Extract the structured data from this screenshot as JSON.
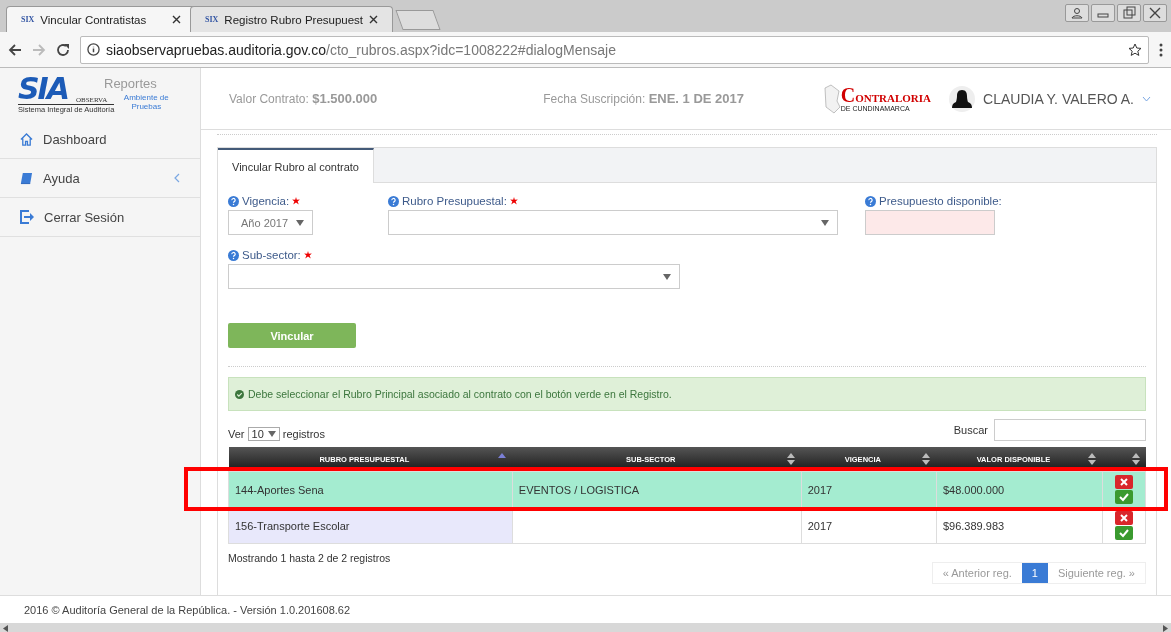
{
  "browser": {
    "tabs": [
      {
        "favicon": "SIX",
        "title": "Vincular Contratistas",
        "selected": true
      },
      {
        "favicon": "SIX",
        "title": "Registro Rubro Presupuest",
        "selected": false
      }
    ],
    "url_host": "siaobservapruebas.auditoria.gov.co",
    "url_path": "/cto_rubros.aspx?idc=1008222#dialogMensaje"
  },
  "header": {
    "logo_text": "SIA",
    "logo_sub": "OBSERVA",
    "logo_caption": "Sistema Integral de Auditoría",
    "environment": "Ambiente de Pruebas",
    "faded_menu": "Reportes",
    "contract_value_label": "Valor Contrato:",
    "contract_value": "$1.500.000",
    "date_label": "Fecha Suscripción:",
    "date_value": "ENE. 1 DE 2017",
    "agency_logo": "CONTRALORIA",
    "agency_sub": "DE CUNDINAMARCA",
    "user": "CLAUDIA Y. VALERO A."
  },
  "sidebar": {
    "items": [
      {
        "kind": "home",
        "label": "Dashboard",
        "submenu": false
      },
      {
        "kind": "book",
        "label": "Ayuda",
        "submenu": true
      },
      {
        "kind": "exit",
        "label": "Cerrar Sesión",
        "submenu": false
      }
    ]
  },
  "panel": {
    "tabs": [
      {
        "label": "Vincular Rubro al contrato",
        "selected": true
      }
    ],
    "fields": [
      {
        "kind": "select",
        "label": "Vigencia:",
        "required": true,
        "value": "Año 2017"
      },
      {
        "kind": "select",
        "label": "Rubro Presupuestal:",
        "required": true
      },
      {
        "kind": "input",
        "label": "Presupuesto disponible:",
        "required": false
      },
      {
        "kind": "select",
        "label": "Sub-sector:",
        "required": true
      }
    ],
    "button": "Vincular",
    "alert": "Debe seleccionar el Rubro Principal asociado al contrato con el botón verde en el Registro.",
    "table": {
      "length_prefix": "Ver",
      "length_value": "10",
      "length_suffix": "registros",
      "search_label": "Buscar",
      "columns": [
        {
          "label": "RUBRO PRESUPUESTAL",
          "sorted": true
        },
        {
          "label": "SUB-SECTOR",
          "sorted": false
        },
        {
          "label": "VIGENCIA",
          "sorted": false
        },
        {
          "label": "VALOR DISPONIBLE",
          "sorted": false
        },
        {
          "sorted": false
        }
      ],
      "rows": [
        {
          "cells": [
            "144-Aportes Sena",
            "EVENTOS / LOGISTICA",
            "2017",
            "$48.000.000"
          ],
          "selected": true,
          "highlighted": true
        },
        {
          "cells": [
            "156-Transporte Escolar",
            "",
            "2017",
            "$96.389.983"
          ],
          "selected": false,
          "highlighted": false
        }
      ],
      "info": "Mostrando 1 hasta 2 de 2 registros",
      "pagination": [
        {
          "label": "« Anterior reg.",
          "selected": false
        },
        {
          "label": "1",
          "selected": true
        },
        {
          "label": "Siguiente reg. »",
          "selected": false
        }
      ]
    }
  },
  "footer": "2016 © Auditoría General de la República. - Versión 1.0.201608.62"
}
